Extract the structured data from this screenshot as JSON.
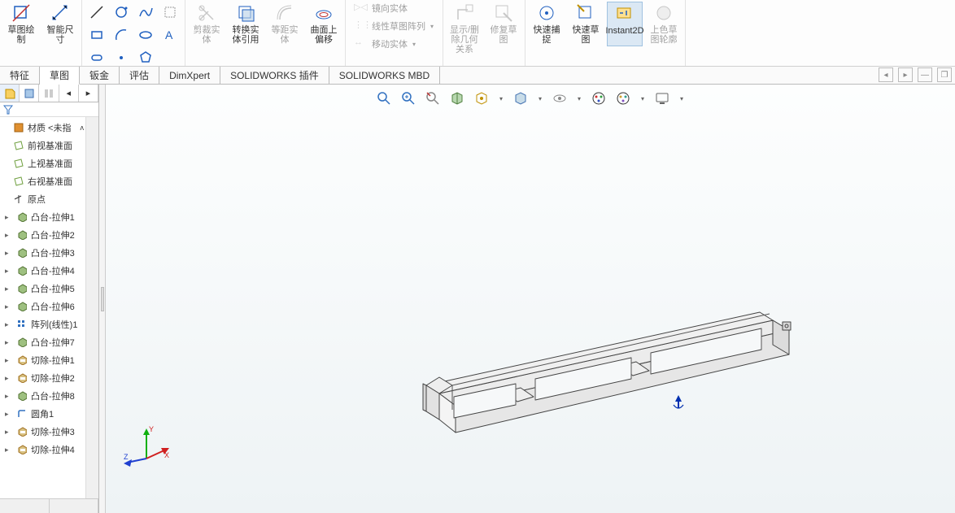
{
  "ribbon": {
    "sketch_draw": "草图绘制",
    "smart_dim": "智能尺寸",
    "trim": "剪裁实体",
    "convert": "转换实体引用",
    "equidist": "等距实体",
    "offset": "曲面上偏移",
    "mirror": "镜向实体",
    "linear_pattern": "线性草图阵列",
    "move": "移动实体",
    "display_rel": "显示/删除几何关系",
    "repair": "修复草图",
    "quick_snap": "快速捕捉",
    "rapid_sketch": "快速草图",
    "instant2d": "Instant2D",
    "shaded_contour": "上色草图轮廓"
  },
  "tabs": {
    "feature": "特征",
    "sketch": "草图",
    "sheetmetal": "钣金",
    "evaluate": "评估",
    "dimxpert": "DimXpert",
    "addins": "SOLIDWORKS 插件",
    "mbd": "SOLIDWORKS MBD"
  },
  "tree": {
    "material": "材质 <未指",
    "front_plane": "前视基准面",
    "top_plane": "上视基准面",
    "right_plane": "右视基准面",
    "origin": "原点",
    "items": [
      "凸台-拉伸1",
      "凸台-拉伸2",
      "凸台-拉伸3",
      "凸台-拉伸4",
      "凸台-拉伸5",
      "凸台-拉伸6",
      "阵列(线性)1",
      "凸台-拉伸7",
      "切除-拉伸1",
      "切除-拉伸2",
      "凸台-拉伸8",
      "圆角1",
      "切除-拉伸3",
      "切除-拉伸4"
    ]
  },
  "triad": {
    "x": "X",
    "y": "Y",
    "z": "Z"
  }
}
